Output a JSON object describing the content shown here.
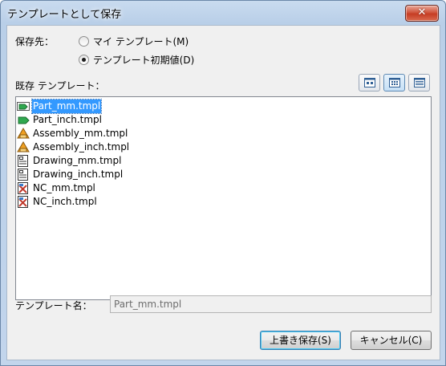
{
  "window": {
    "title": "テンプレートとして保存",
    "close_label": "✕"
  },
  "save_to": {
    "label": "保存先：",
    "options": [
      {
        "label": "マイ テンプレート(M)",
        "checked": false
      },
      {
        "label": "テンプレート初期値(D)",
        "checked": true
      }
    ]
  },
  "existing": {
    "label": "既存 テンプレート：",
    "view_buttons": [
      {
        "icon": "large-icons-view-icon",
        "active": false
      },
      {
        "icon": "small-icons-view-icon",
        "active": true
      },
      {
        "icon": "details-view-icon",
        "active": false
      }
    ],
    "items": [
      {
        "name": "Part_mm.tmpl",
        "icon": "part-template-icon",
        "selected": true
      },
      {
        "name": "Part_inch.tmpl",
        "icon": "part-template-icon",
        "selected": false
      },
      {
        "name": "Assembly_mm.tmpl",
        "icon": "assembly-template-icon",
        "selected": false
      },
      {
        "name": "Assembly_inch.tmpl",
        "icon": "assembly-template-icon",
        "selected": false
      },
      {
        "name": "Drawing_mm.tmpl",
        "icon": "drawing-template-icon",
        "selected": false
      },
      {
        "name": "Drawing_inch.tmpl",
        "icon": "drawing-template-icon",
        "selected": false
      },
      {
        "name": "NC_mm.tmpl",
        "icon": "nc-template-icon",
        "selected": false
      },
      {
        "name": "NC_inch.tmpl",
        "icon": "nc-template-icon",
        "selected": false
      }
    ]
  },
  "template_name": {
    "label": "テンプレート名：",
    "value": "Part_mm.tmpl"
  },
  "buttons": {
    "overwrite_save": "上書き保存(S)",
    "cancel": "キャンセル(C)"
  },
  "colors": {
    "selection": "#3399ff",
    "close_button": "#c63d24",
    "title_gradient": "#b9cfe8"
  }
}
